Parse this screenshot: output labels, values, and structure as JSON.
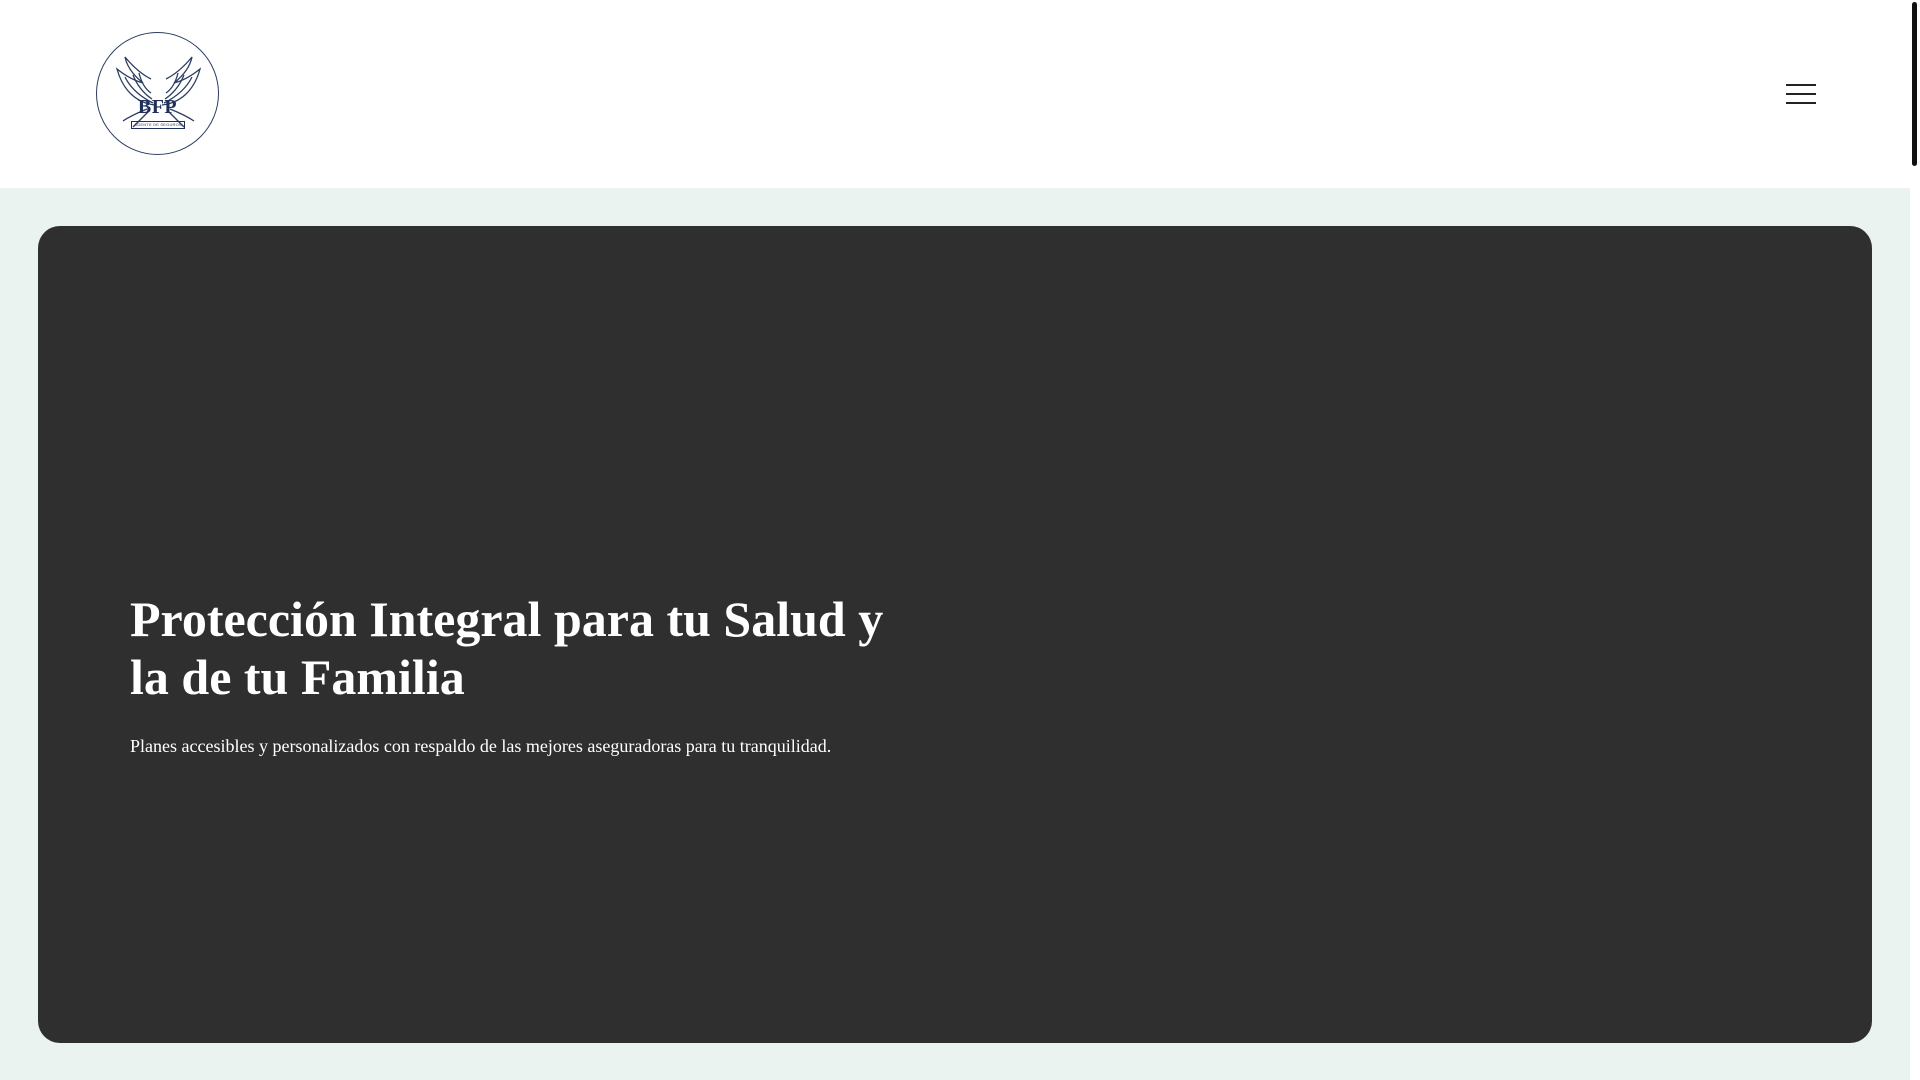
{
  "header": {
    "logo": {
      "text": "BFP",
      "subtext": "AGENTE DE SEGUROS",
      "icon": "angel-wings-icon",
      "color": "#1f2f57"
    },
    "menu_icon": "hamburger-menu-icon"
  },
  "hero": {
    "title": "Protección Integral para tu Salud y la de tu Familia",
    "subtitle": "Planes accesibles y personalizados con respaldo de las mejores aseguradoras para tu tranquilidad.",
    "background_color": "#2f2f2f"
  },
  "colors": {
    "page_background": "#eaf3f0",
    "header_background": "#ffffff",
    "text_on_hero": "#ffffff"
  }
}
